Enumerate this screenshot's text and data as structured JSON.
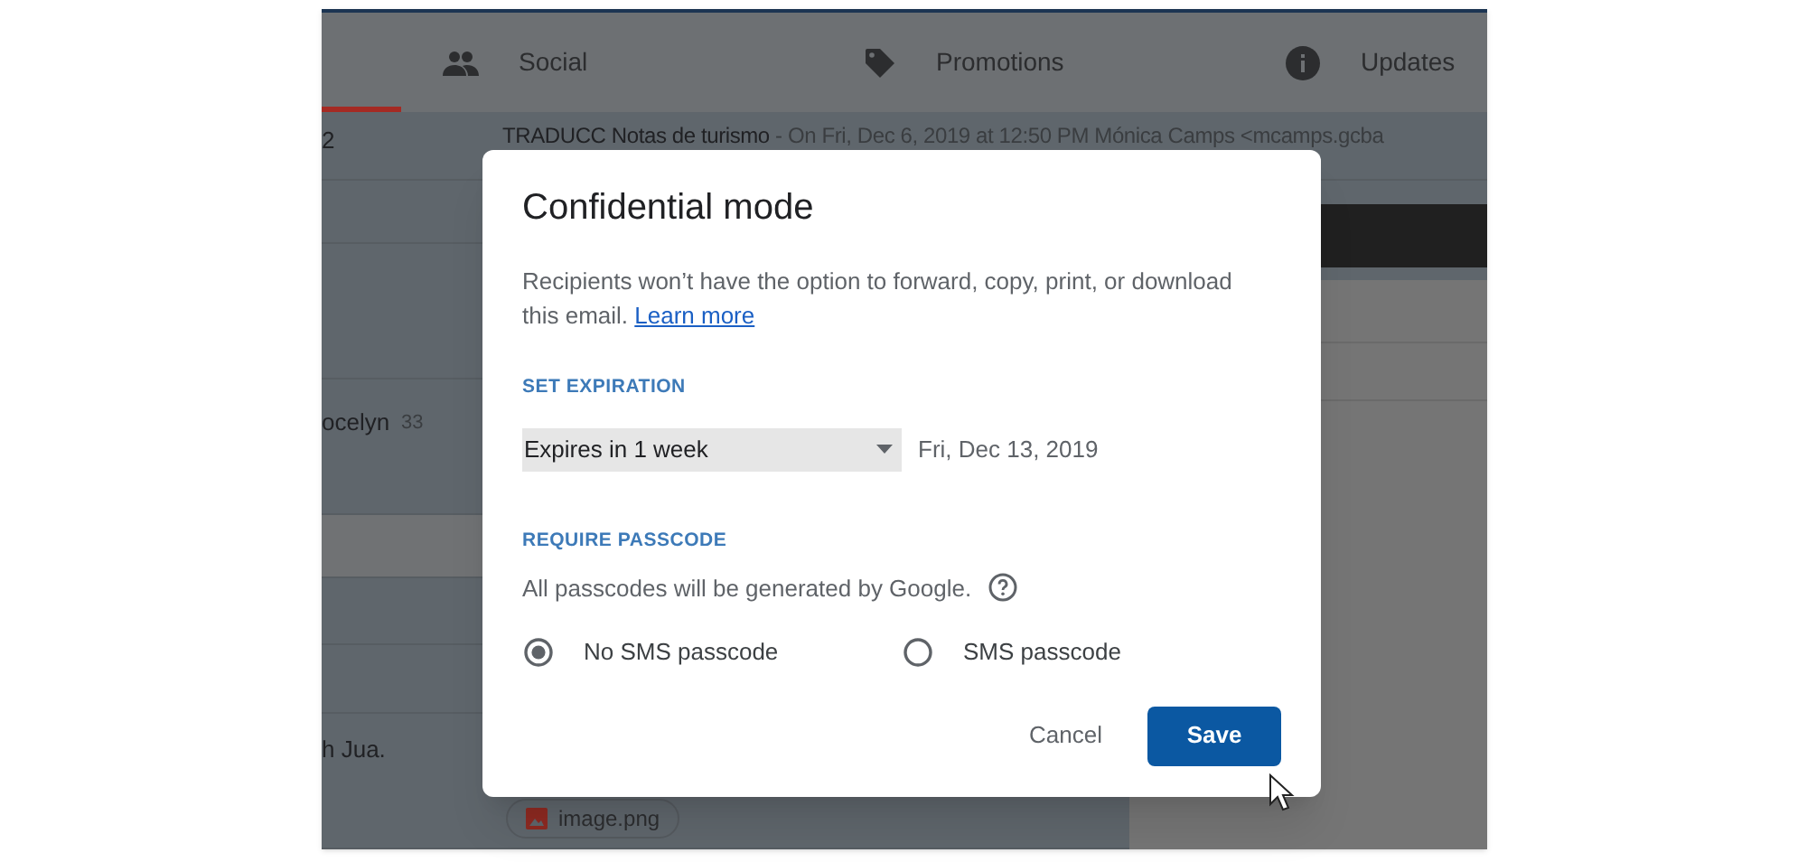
{
  "inbox": {
    "tabs": [
      {
        "selected": true
      },
      {
        "label": "Social",
        "selected": false
      },
      {
        "label": "Promotions",
        "selected": false
      },
      {
        "label": "Updates",
        "selected": false
      }
    ],
    "rows": [
      {
        "sender": "2",
        "subject": "TRADUCC Notas de turismo",
        "snippet": "- On Fri, Dec 6, 2019 at 12:50 PM Mónica Camps <mcamps.gcba",
        "selected": false
      },
      {
        "selected": false
      },
      {
        "selected": false
      },
      {
        "sender": "ocelyn",
        "count": "33",
        "selected": false
      },
      {
        "selected": true
      },
      {
        "selected": false
      },
      {
        "selected": false
      },
      {
        "sender": "h Jua.",
        "attachment": "image.png",
        "selected": false
      }
    ]
  },
  "dialog": {
    "title": "Confidential mode",
    "description": "Recipients won’t have the option to forward, copy, print, or download this email.",
    "link": "Learn more",
    "expiration": {
      "heading": "SET EXPIRATION",
      "value": "Expires in 1 week",
      "date": "Fri, Dec 13, 2019"
    },
    "passcode": {
      "heading": "REQUIRE PASSCODE",
      "note": "All passcodes will be generated by Google.",
      "options": [
        {
          "label": "No SMS passcode",
          "selected": true
        },
        {
          "label": "SMS passcode",
          "selected": false
        }
      ]
    },
    "buttons": {
      "cancel": "Cancel",
      "save": "Save"
    }
  }
}
